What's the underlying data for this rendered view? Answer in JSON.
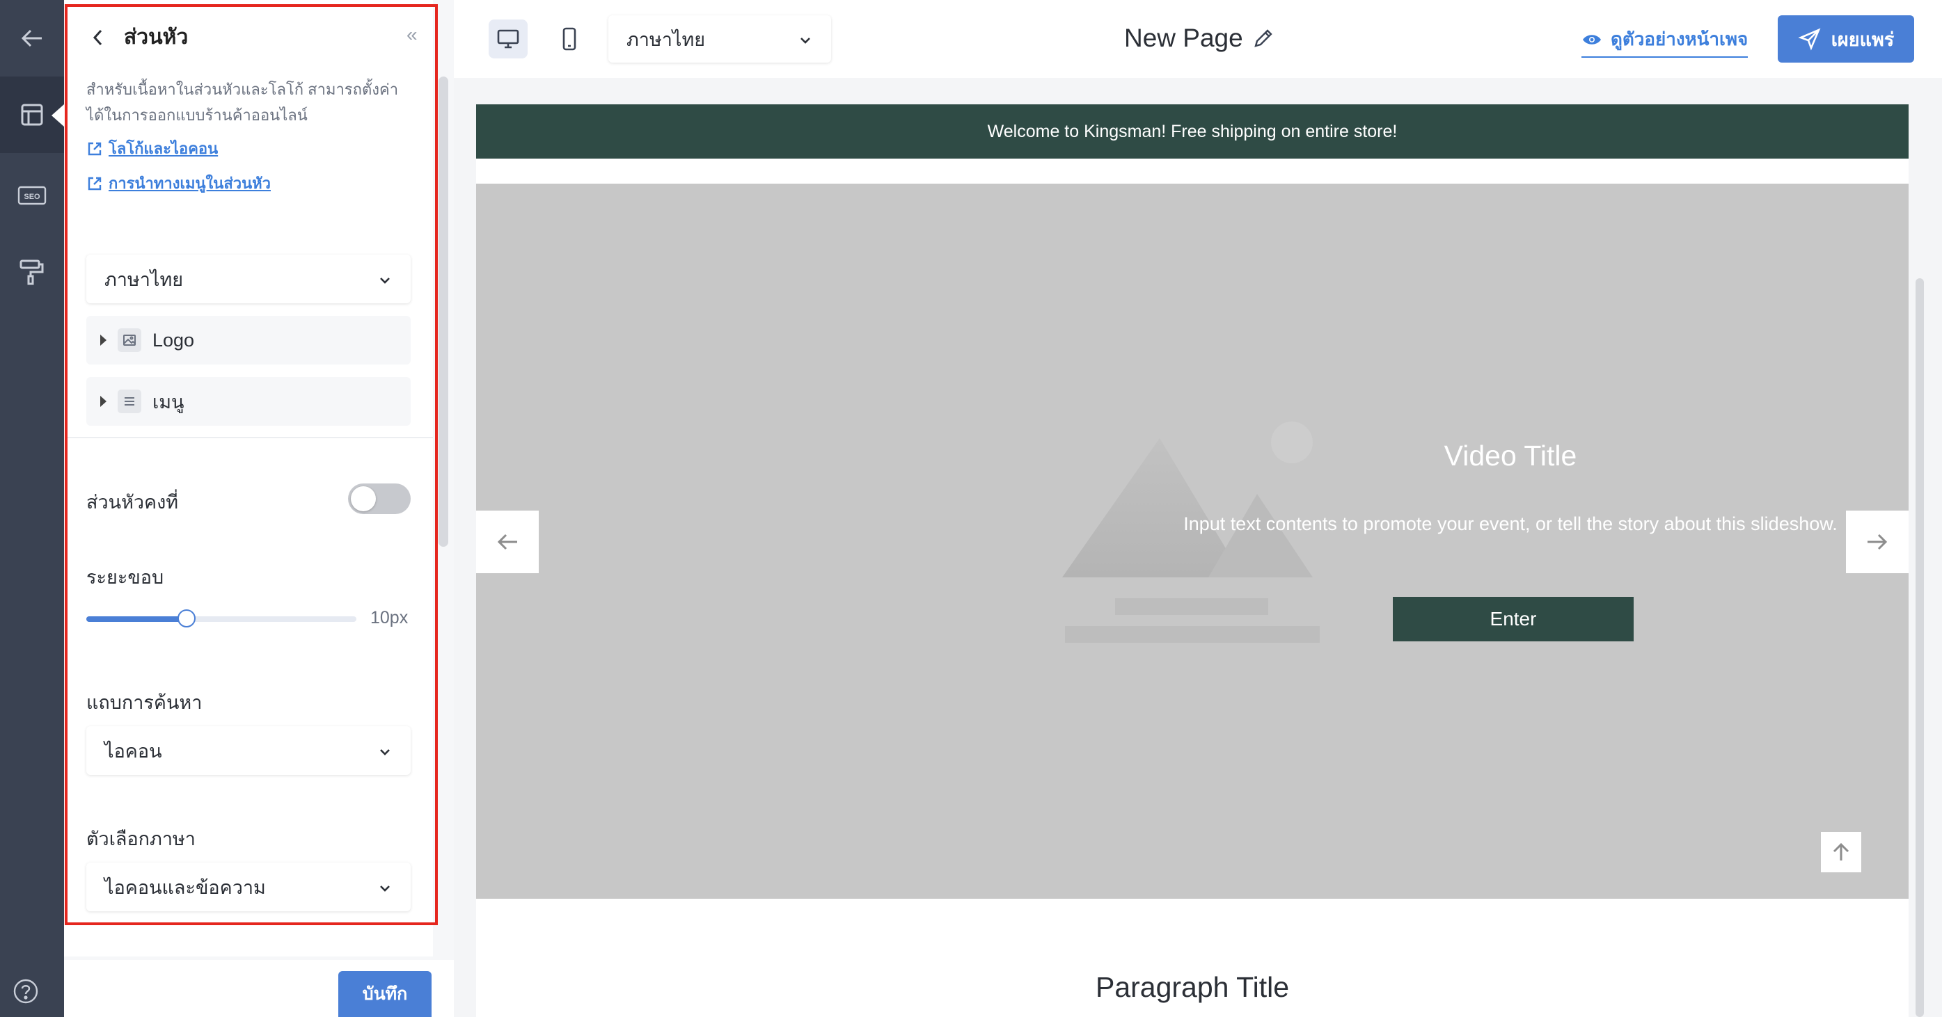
{
  "left_nav": {
    "icons": [
      "back-arrow-icon",
      "layout-icon",
      "seo-icon",
      "paint-roller-icon",
      "help-icon"
    ],
    "seo_badge": "SEO"
  },
  "panel": {
    "title": "ส่วนหัว",
    "description": "สำหรับเนื้อหาในส่วนหัวและโลโก้ สามารถตั้งค่าได้ในการออกแบบร้านค้าออนไลน์",
    "links": [
      {
        "label": "โลโก้และไอคอน"
      },
      {
        "label": "การนำทางเมนูในส่วนหัว"
      }
    ],
    "language_select": "ภาษาไทย",
    "tree": [
      {
        "label": "Logo",
        "icon": "image-icon"
      },
      {
        "label": "เมนู",
        "icon": "menu-icon"
      }
    ],
    "sticky_header": {
      "label": "ส่วนหัวคงที่",
      "enabled": false
    },
    "padding": {
      "label": "ระยะขอบ",
      "value_text": "10px",
      "fraction": 0.37
    },
    "search_bar": {
      "label": "แถบการค้นหา",
      "value": "ไอคอน"
    },
    "language_selector": {
      "label": "ตัวเลือกภาษา",
      "value": "ไอคอนและข้อความ"
    },
    "save_label": "บันทึก"
  },
  "toolbar": {
    "language": "ภาษาไทย",
    "page_title": "New Page",
    "preview_label": "ดูตัวอย่างหน้าเพจ",
    "publish_label": "เผยแพร่"
  },
  "canvas": {
    "announcement": "Welcome to Kingsman! Free shipping on entire store!",
    "hero": {
      "title": "Video Title",
      "description": "Input text contents to promote your event, or tell the story about this slideshow.",
      "button": "Enter"
    },
    "paragraph_title": "Paragraph Title"
  },
  "colors": {
    "accent": "#4a7fd6",
    "rail": "#3a4252",
    "banner": "#2f4b45",
    "highlight_frame": "#e5261e"
  }
}
